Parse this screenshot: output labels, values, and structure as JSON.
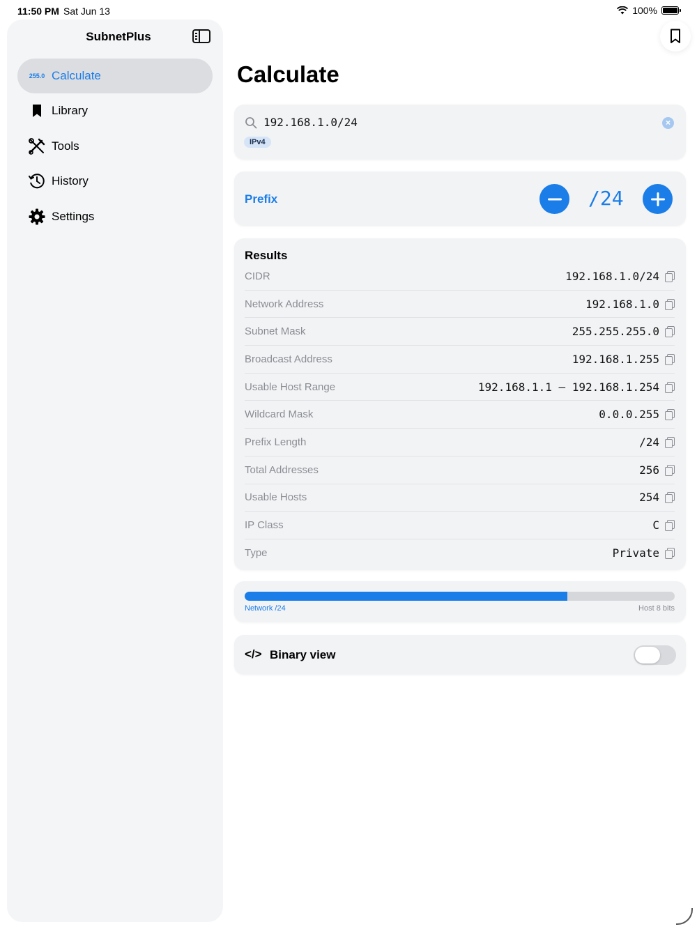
{
  "status": {
    "time": "11:50 PM",
    "date": "Sat Jun 13",
    "battery": "100%"
  },
  "sidebar": {
    "title": "SubnetPlus",
    "items": [
      {
        "label": "Calculate",
        "icon": "255.0",
        "active": true
      },
      {
        "label": "Library",
        "icon": "bookmark-icon"
      },
      {
        "label": "Tools",
        "icon": "tools-icon"
      },
      {
        "label": "History",
        "icon": "history-icon"
      },
      {
        "label": "Settings",
        "icon": "gear-icon"
      }
    ]
  },
  "main": {
    "title": "Calculate",
    "search": {
      "value": "192.168.1.0/24",
      "badge": "IPv4"
    },
    "prefix": {
      "label": "Prefix",
      "value": "/24",
      "minus": "−",
      "plus": "+"
    },
    "results": {
      "heading": "Results",
      "rows": [
        {
          "key": "CIDR",
          "value": "192.168.1.0/24"
        },
        {
          "key": "Network Address",
          "value": "192.168.1.0"
        },
        {
          "key": "Subnet Mask",
          "value": "255.255.255.0"
        },
        {
          "key": "Broadcast Address",
          "value": "192.168.1.255"
        },
        {
          "key": "Usable Host Range",
          "value": "192.168.1.1 – 192.168.1.254"
        },
        {
          "key": "Wildcard Mask",
          "value": "0.0.0.255"
        },
        {
          "key": "Prefix Length",
          "value": "/24"
        },
        {
          "key": "Total Addresses",
          "value": "256"
        },
        {
          "key": "Usable Hosts",
          "value": "254"
        },
        {
          "key": "IP Class",
          "value": "C"
        },
        {
          "key": "Type",
          "value": "Private"
        }
      ]
    },
    "bits_bar": {
      "network_label": "Network /24",
      "host_label": "Host 8 bits",
      "network_fraction": 0.75
    },
    "binary": {
      "code_icon": "</>",
      "label": "Binary view",
      "enabled": false
    }
  },
  "colors": {
    "accent": "#1a7de8"
  }
}
